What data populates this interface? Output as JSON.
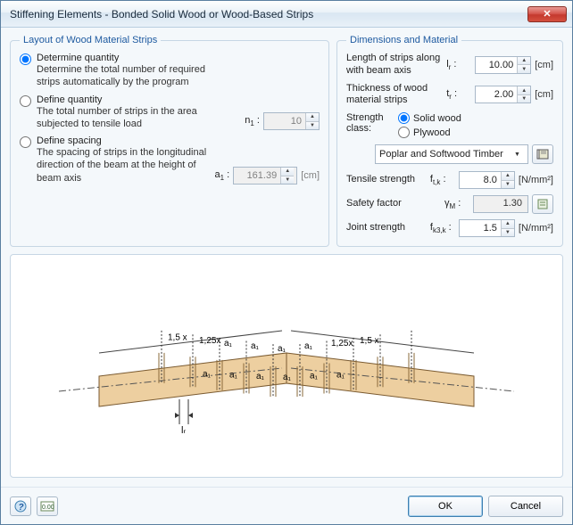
{
  "window": {
    "title": "Stiffening Elements - Bonded Solid Wood or Wood-Based Strips",
    "close_glyph": "✕"
  },
  "layout_group": {
    "legend": "Layout of Wood Material Strips",
    "opt_determine": {
      "title": "Determine quantity",
      "desc": "Determine the total number of required strips automatically by the program"
    },
    "opt_define_qty": {
      "title": "Define quantity",
      "desc": "The total number of strips in the area subjected to tensile load",
      "sym_html": "n",
      "sub": "1",
      "value": "10"
    },
    "opt_define_spacing": {
      "title": "Define spacing",
      "desc": "The spacing of strips in the longitudinal direction of the beam at the height of beam axis",
      "sym_html": "a",
      "sub": "1",
      "value": "161.39",
      "unit": "[cm]"
    }
  },
  "dim_group": {
    "legend": "Dimensions and Material",
    "length_label": "Length of strips along with beam axis",
    "length_sym": "l",
    "length_sub": "r",
    "length_val": "10.00",
    "length_unit": "[cm]",
    "thick_label": "Thickness of wood material strips",
    "thick_sym": "t",
    "thick_sub": "r",
    "thick_val": "2.00",
    "thick_unit": "[cm]",
    "strength_class_label": "Strength class:",
    "radio_solid": "Solid wood",
    "radio_ply": "Plywood",
    "combo_val": "Poplar and Softwood Timber",
    "tensile_label": "Tensile strength",
    "tensile_sym": "f",
    "tensile_sub": "t,k",
    "tensile_val": "8.0",
    "tensile_unit": "[N/mm²]",
    "safety_label": "Safety factor",
    "safety_sym": "γ",
    "safety_sub": "M",
    "safety_val": "1.30",
    "joint_label": "Joint strength",
    "joint_sym": "f",
    "joint_sub": "k3,k",
    "joint_val": "1.5",
    "joint_unit": "[N/mm²]"
  },
  "diagram": {
    "labels": [
      "1,5 x",
      "1,25x",
      "a₁",
      "a₁",
      "a₁",
      "a₁",
      "1,25x",
      "1,5 x"
    ],
    "lower": [
      "a₁",
      "a₁",
      "a₁",
      "a₁",
      "a₁",
      "a₁"
    ],
    "lr": "lᵣ"
  },
  "footer": {
    "ok": "OK",
    "cancel": "Cancel"
  }
}
